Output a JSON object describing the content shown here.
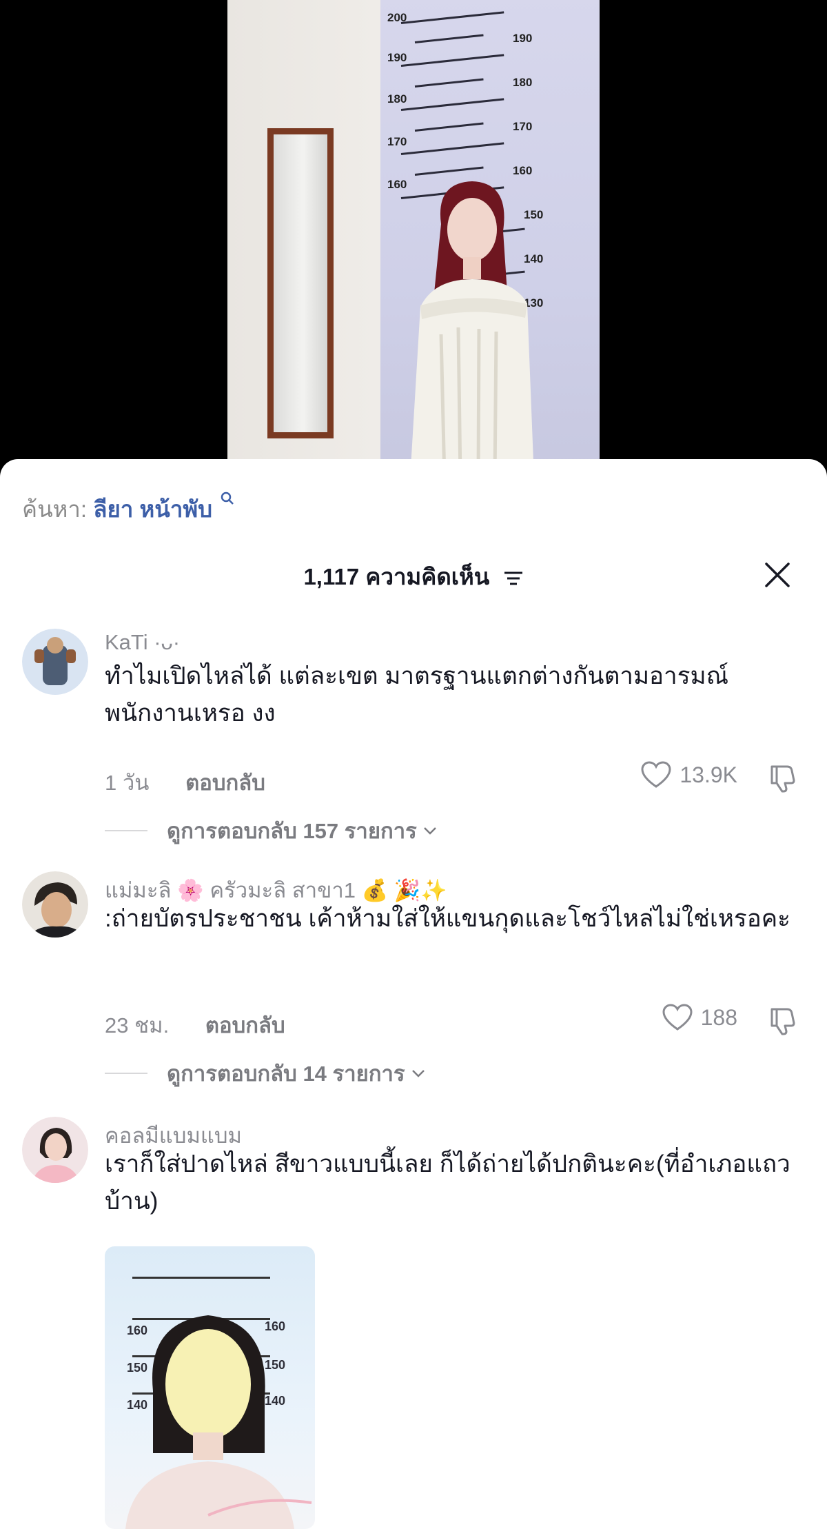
{
  "video": {
    "scale_numbers": [
      "200",
      "190",
      "190",
      "180",
      "180",
      "170",
      "170",
      "160",
      "160",
      "150",
      "140",
      "130"
    ]
  },
  "search": {
    "label": "ค้นหา:",
    "query": "ลียา หน้าพับ"
  },
  "header": {
    "count_label": "1,117 ความคิดเห็น"
  },
  "comments": [
    {
      "username": "KaTi ·ᴗ·",
      "text": "ทำไมเปิดไหล่ได้ แต่ละเขต มาตรฐานแตกต่างกันตามอารมณ์พนักงานเหรอ งง",
      "time": "1 วัน",
      "reply_label": "ตอบกลับ",
      "likes": "13.9K",
      "view_replies": "ดูการตอบกลับ 157 รายการ"
    },
    {
      "username": "แม่มะลิ 🌸 ครัวมะลิ สาขา1 💰 🎉✨",
      "text": ":ถ่ายบัตรประชาชน เค้าห้ามใส่ให้แขนกุดและโชว์ไหล่ไม่ใช่เหรอคะ",
      "time": "23 ชม.",
      "reply_label": "ตอบกลับ",
      "likes": "188",
      "view_replies": "ดูการตอบกลับ 14 รายการ"
    },
    {
      "username": "คอลมีแบมแบม",
      "text": "เราก็ใส่ปาดไหล่ สีขาวแบบนี้เลย ก็ได้ถ่ายได้ปกตินะคะ(ที่อำเภอแถวบ้าน)",
      "attachment_scale": [
        "160",
        "160",
        "150",
        "150",
        "140",
        "140"
      ]
    }
  ]
}
